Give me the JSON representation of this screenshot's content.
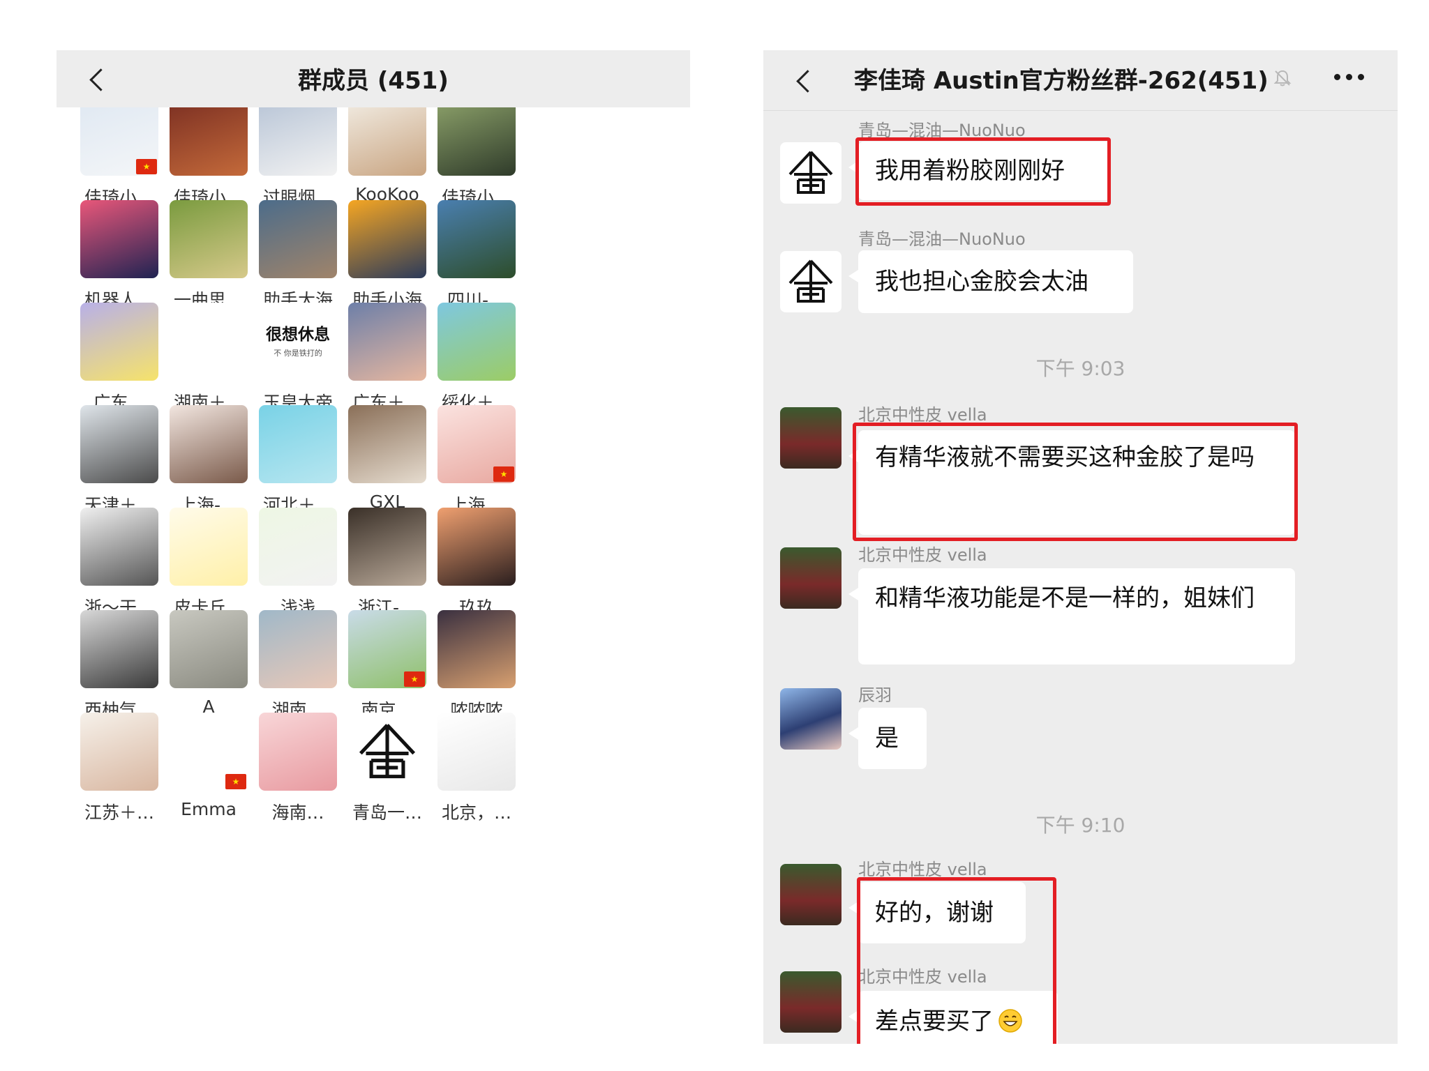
{
  "left_panel": {
    "title": "群成员 (451)",
    "members": [
      {
        "name": "佳琦小…",
        "flag": true
      },
      {
        "name": "佳琦小…",
        "flag": false
      },
      {
        "name": "过眼烟…",
        "flag": false
      },
      {
        "name": "KooKoo",
        "flag": false
      },
      {
        "name": "佳琦小…",
        "flag": false
      },
      {
        "name": "机器人…",
        "flag": false
      },
      {
        "name": "一曲思…",
        "flag": false
      },
      {
        "name": "助手大海",
        "flag": false
      },
      {
        "name": "助手小海",
        "flag": false
      },
      {
        "name": "四川-…",
        "flag": false
      },
      {
        "name": "广东…",
        "flag": false
      },
      {
        "name": "湖南＋…",
        "flag": false
      },
      {
        "name": "玉皇大帝",
        "flag": false,
        "avatar_text": "很想休息",
        "avatar_sub": "不 你是铁打的"
      },
      {
        "name": "广东＋…",
        "flag": false
      },
      {
        "name": "绥化＋…",
        "flag": false
      },
      {
        "name": "天津＋…",
        "flag": false
      },
      {
        "name": "上海-…",
        "flag": false
      },
      {
        "name": "河北＋…",
        "flag": false
      },
      {
        "name": "GXL",
        "flag": false
      },
      {
        "name": "上海…",
        "flag": true
      },
      {
        "name": "浙～干…",
        "flag": false
      },
      {
        "name": "皮卡丘…",
        "flag": false
      },
      {
        "name": "浅浅",
        "flag": false
      },
      {
        "name": "浙江-…",
        "flag": false
      },
      {
        "name": "玖玖",
        "flag": false
      },
      {
        "name": "西柚气…",
        "flag": false
      },
      {
        "name": "A",
        "flag": false
      },
      {
        "name": "湖南…",
        "flag": false
      },
      {
        "name": "南京…",
        "flag": true
      },
      {
        "name": "哝哝哝",
        "flag": false
      },
      {
        "name": "江苏＋…",
        "flag": false
      },
      {
        "name": "Emma",
        "flag": true
      },
      {
        "name": "海南…",
        "flag": false
      },
      {
        "name": "青岛一…",
        "flag": false
      },
      {
        "name": "北京，…",
        "flag": false
      }
    ]
  },
  "right_panel": {
    "title": "李佳琦 Austin官方粉丝群-262(451)",
    "icons": {
      "mute": "bell-off-icon",
      "more": "more-dots-icon",
      "back": "back-chevron-icon"
    },
    "messages": [
      {
        "sender": "青岛—混油—NuoNuo",
        "text": "我用着粉胶刚刚好",
        "highlight": true
      },
      {
        "sender": "青岛—混油—NuoNuo",
        "text": "我也担心金胶会太油",
        "highlight": false
      },
      {
        "time": "下午 9:03"
      },
      {
        "sender": "北京中性皮 vella",
        "text": "有精华液就不需要买这种金胶了是吗",
        "highlight": true
      },
      {
        "sender": "北京中性皮 vella",
        "text": "和精华液功能是不是一样的，姐妹们",
        "highlight": false
      },
      {
        "sender": "辰羽",
        "text": "是",
        "highlight": false
      },
      {
        "time": "下午 9:10"
      },
      {
        "sender": "北京中性皮 vella",
        "text": "好的，谢谢",
        "highlight": true
      },
      {
        "sender": "北京中性皮 vella",
        "text": "差点要买了",
        "emoji": "grinning-emoji",
        "highlight": true
      }
    ]
  },
  "colors": {
    "highlight": "#e31e24",
    "chat_bg": "#ededed",
    "bubble": "#ffffff",
    "flag": "#de2910"
  }
}
